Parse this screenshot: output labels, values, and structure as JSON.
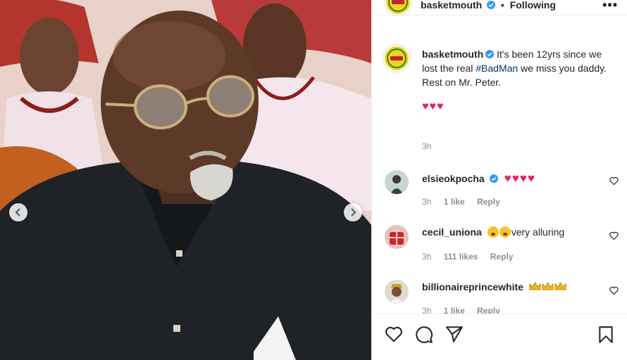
{
  "post": {
    "username": "basketmouth",
    "following_label": "Following",
    "more_label": "•••",
    "caption_before": "It's been 12yrs since we lost the real ",
    "caption_hashtag": "#BadMan",
    "caption_after": " we miss you daddy.",
    "caption_line2": "Rest on Mr. Peter.",
    "caption_hearts": "♥♥♥",
    "caption_time": "3h"
  },
  "comments": [
    {
      "username": "elsieokpocha",
      "verified": true,
      "text": "♥♥♥♥",
      "time": "3h",
      "likes": "1 like",
      "reply": "Reply"
    },
    {
      "username": "cecil_uniona",
      "verified": false,
      "text": "very alluring",
      "time": "3h",
      "likes": "111 likes",
      "reply": "Reply"
    },
    {
      "username": "billionaireprincewhite",
      "verified": false,
      "text": "",
      "time": "3h",
      "likes": "1 like",
      "reply": "Reply"
    }
  ],
  "icons": {
    "verified": "verified-badge-icon",
    "like": "heart-outline-icon",
    "comment": "comment-bubble-icon",
    "share": "paper-plane-icon",
    "save": "bookmark-icon",
    "prev": "chevron-left-icon",
    "next": "chevron-right-icon"
  },
  "colors": {
    "verified_blue": "#3897f0",
    "link": "#00376b",
    "heart_red": "#e0245e",
    "muted_text": "#8e8e8e",
    "brand_yellow": "#f6d21b"
  }
}
